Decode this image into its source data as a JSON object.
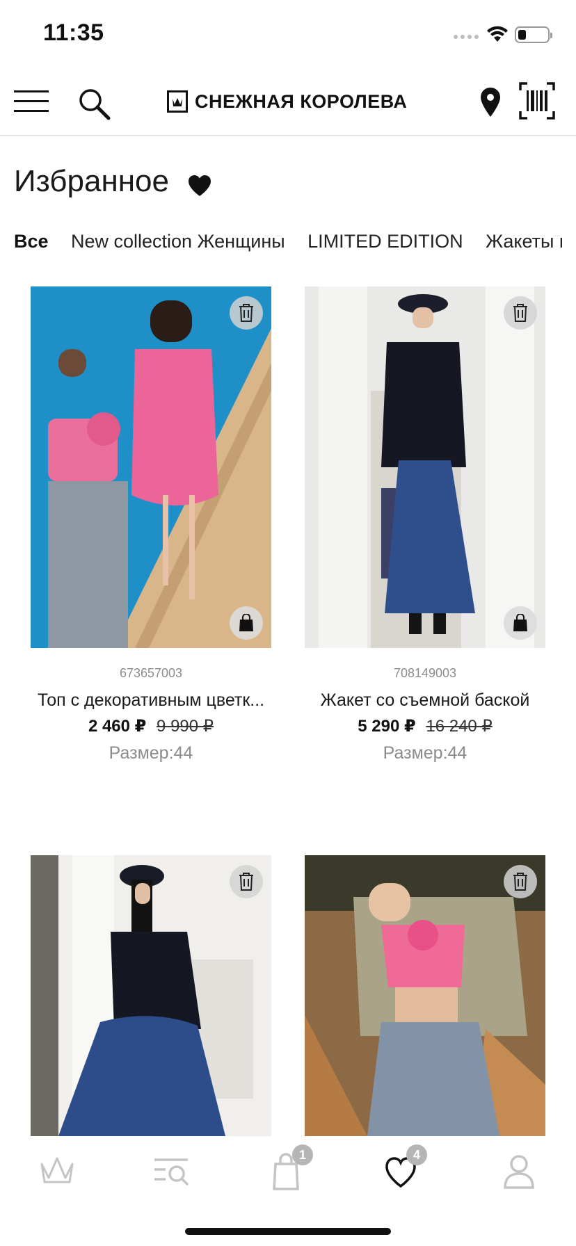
{
  "status_bar": {
    "time": "11:35",
    "battery_level": 0.25
  },
  "header": {
    "brand": "СНЕЖНАЯ КОРОЛЕВА",
    "icons": [
      "menu-icon",
      "search-icon",
      "location-pin-icon",
      "barcode-icon"
    ]
  },
  "page": {
    "title": "Избранное"
  },
  "tabs": [
    {
      "label": "Все",
      "active": true
    },
    {
      "label": "New collection Женщины",
      "active": false
    },
    {
      "label": "LIMITED EDITION",
      "active": false
    },
    {
      "label": "Жакеты и",
      "active": false
    }
  ],
  "products": [
    {
      "sku": "673657003",
      "name": "Топ с декоративным цветк...",
      "price": "2 460 ₽",
      "old_price": "9 990 ₽",
      "size": "Размер:44",
      "image": "pink-top-poolside-photo"
    },
    {
      "sku": "708149003",
      "name": "Жакет со съемной баской",
      "price": "5 290 ₽",
      "old_price": "16 240 ₽",
      "size": "Размер:44",
      "image": "navy-jacket-denim-skirt-photo"
    },
    {
      "image": "navy-jacket-cap-photo"
    },
    {
      "image": "pink-top-sunbathing-photo"
    }
  ],
  "bottom_nav": {
    "items": [
      {
        "icon": "crown-icon"
      },
      {
        "icon": "catalog-search-icon"
      },
      {
        "icon": "shopping-bag-icon",
        "badge": "1"
      },
      {
        "icon": "heart-icon",
        "badge": "4",
        "active": true
      },
      {
        "icon": "profile-icon"
      }
    ]
  },
  "colors": {
    "text": "#111111",
    "muted": "#8c8c8c",
    "divider": "#e4e4e4",
    "badge": "#b5b5b5",
    "nav_inactive": "#c4c4c4"
  }
}
